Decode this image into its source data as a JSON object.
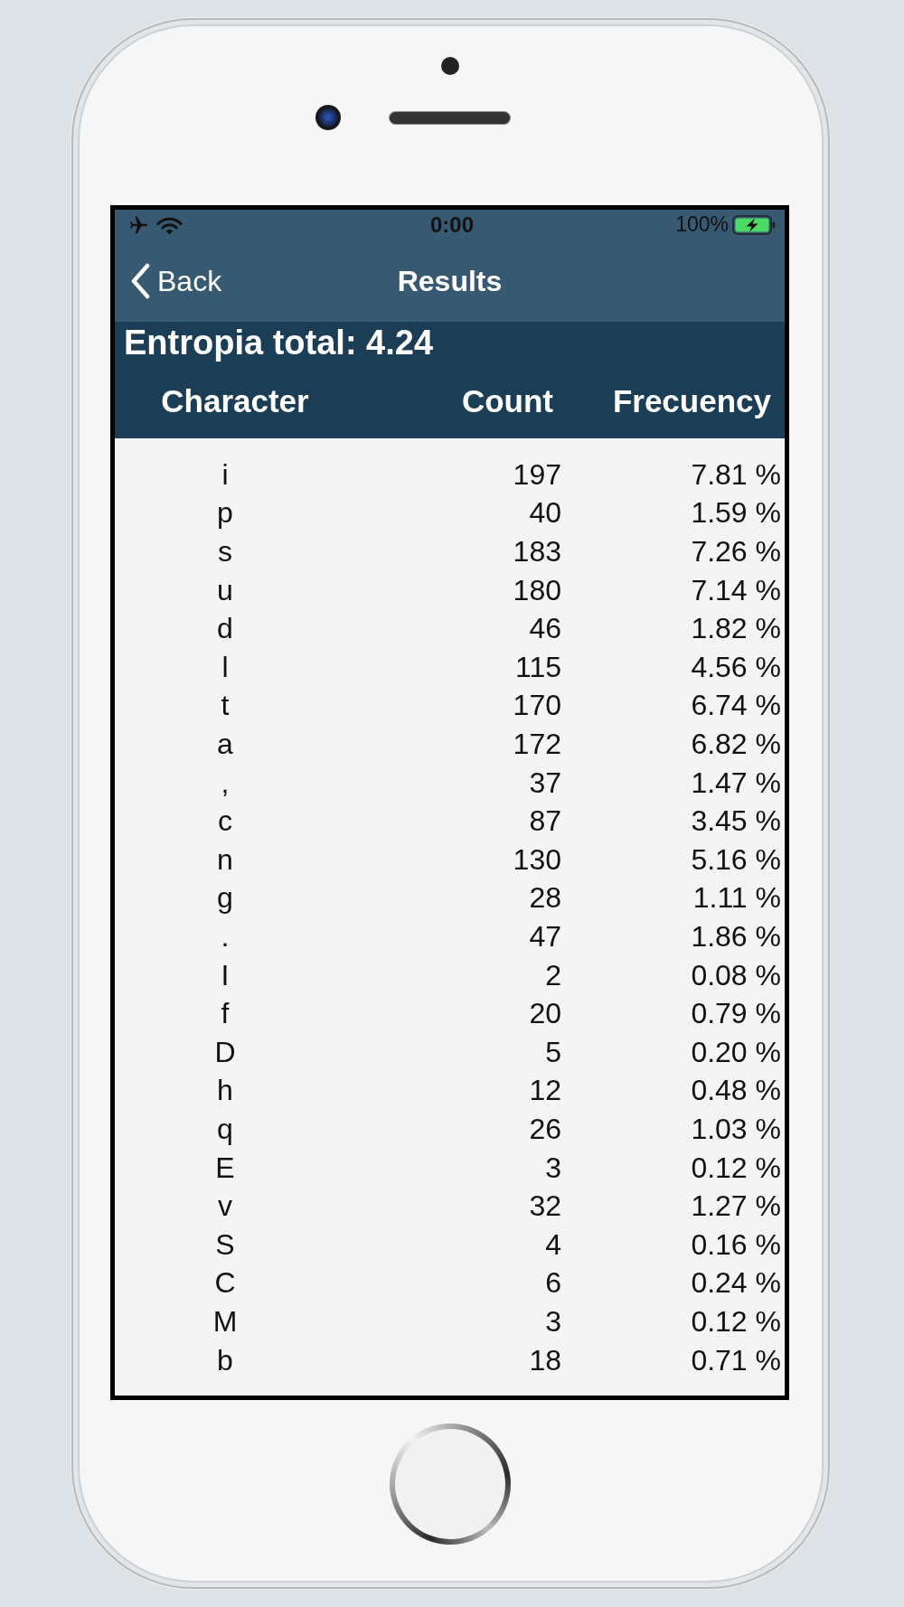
{
  "status_bar": {
    "time": "0:00",
    "battery": "100%"
  },
  "nav_bar": {
    "back": "Back",
    "title": "Results"
  },
  "summary": {
    "entropy": "Entropia total: 4.24"
  },
  "table": {
    "columns": [
      "Character",
      "Count",
      "Frecuency"
    ],
    "rows": [
      {
        "character": "i",
        "count": "197",
        "frequency": "7.81 %"
      },
      {
        "character": "p",
        "count": "40",
        "frequency": "1.59 %"
      },
      {
        "character": "s",
        "count": "183",
        "frequency": "7.26 %"
      },
      {
        "character": "u",
        "count": "180",
        "frequency": "7.14 %"
      },
      {
        "character": "d",
        "count": "46",
        "frequency": "1.82 %"
      },
      {
        "character": "l",
        "count": "115",
        "frequency": "4.56 %"
      },
      {
        "character": "t",
        "count": "170",
        "frequency": "6.74 %"
      },
      {
        "character": "a",
        "count": "172",
        "frequency": "6.82 %"
      },
      {
        "character": ",",
        "count": "37",
        "frequency": "1.47 %"
      },
      {
        "character": "c",
        "count": "87",
        "frequency": "3.45 %"
      },
      {
        "character": "n",
        "count": "130",
        "frequency": "5.16 %"
      },
      {
        "character": "g",
        "count": "28",
        "frequency": "1.11 %"
      },
      {
        "character": ".",
        "count": "47",
        "frequency": "1.86 %"
      },
      {
        "character": "I",
        "count": "2",
        "frequency": "0.08 %"
      },
      {
        "character": "f",
        "count": "20",
        "frequency": "0.79 %"
      },
      {
        "character": "D",
        "count": "5",
        "frequency": "0.20 %"
      },
      {
        "character": "h",
        "count": "12",
        "frequency": "0.48 %"
      },
      {
        "character": "q",
        "count": "26",
        "frequency": "1.03 %"
      },
      {
        "character": "E",
        "count": "3",
        "frequency": "0.12 %"
      },
      {
        "character": "v",
        "count": "32",
        "frequency": "1.27 %"
      },
      {
        "character": "S",
        "count": "4",
        "frequency": "0.16 %"
      },
      {
        "character": "C",
        "count": "6",
        "frequency": "0.24 %"
      },
      {
        "character": "M",
        "count": "3",
        "frequency": "0.12 %"
      },
      {
        "character": "b",
        "count": "18",
        "frequency": "0.71 %"
      }
    ]
  }
}
